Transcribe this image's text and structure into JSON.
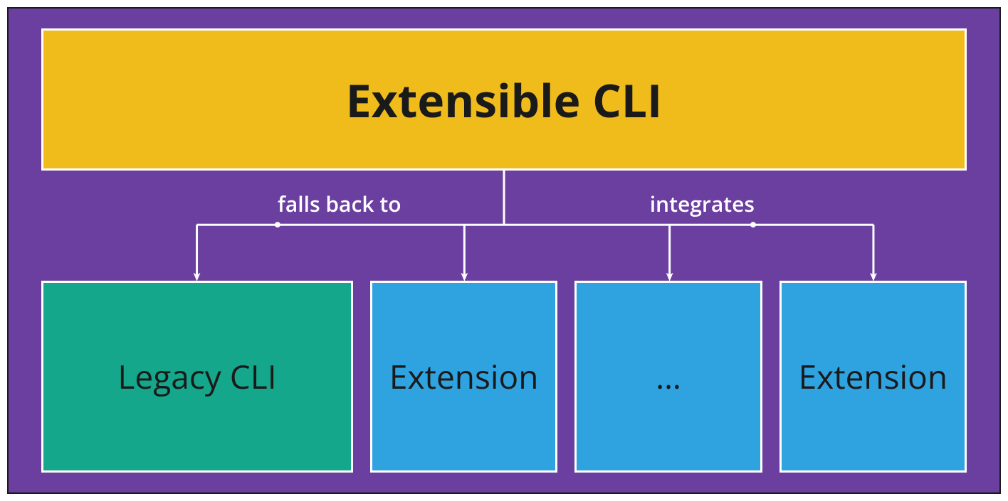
{
  "top": {
    "title": "Extensible CLI"
  },
  "edges": {
    "fallback_label": "falls back to",
    "integrate_label": "integrates"
  },
  "bottom": {
    "legacy": "Legacy CLI",
    "ext1": "Extension",
    "ext2": "…",
    "ext3": "Extension"
  },
  "colors": {
    "bg": "#6b3fa0",
    "top": "#f0bc1c",
    "legacy": "#15a78b",
    "ext": "#2fa2e0",
    "border": "#ffffff"
  }
}
